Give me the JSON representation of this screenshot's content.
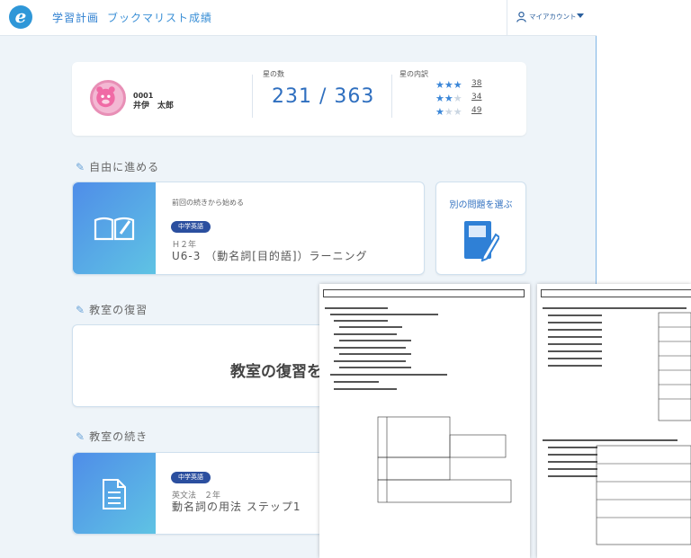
{
  "nav": {
    "logo": "e",
    "items": [
      "学習計画",
      "ブックマリスト",
      "成績"
    ],
    "account": "マイアカウント"
  },
  "student": {
    "id": "0001",
    "name": "井伊　太郎"
  },
  "stats": {
    "count_label": "星の数",
    "count": "231 / 363",
    "breakdown_label": "星の内訳",
    "ratings": [
      {
        "stars": 3,
        "count": "38"
      },
      {
        "stars": 2,
        "count": "34"
      },
      {
        "stars": 1,
        "count": "49"
      }
    ]
  },
  "free": {
    "title": "自由に進める",
    "lead": "前回の続きから始める",
    "tag": "中学英語",
    "grade": "Ｈ２年",
    "unit": "U6-3 （動名詞[目的語]）ラーニング",
    "other_label": "別の問題を選ぶ"
  },
  "review": {
    "title": "教室の復習",
    "body": "教室の復習を"
  },
  "continue": {
    "title": "教室の続き",
    "tag": "中学英語",
    "grade": "英文法　２年",
    "unit": "動名詞の用法 ステップ1"
  },
  "colors": {
    "accent": "#2f6fbf",
    "tag": "#2b4f9f",
    "gradient_start": "#4f8de8",
    "gradient_end": "#5fc3e4"
  },
  "icons": [
    "user-icon",
    "book-icon",
    "document-icon",
    "pencil-icon",
    "star-icon"
  ]
}
